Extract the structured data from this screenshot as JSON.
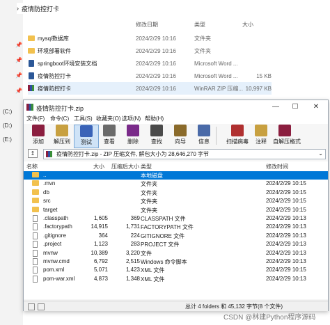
{
  "explorer": {
    "breadcrumb": "疫情防控打卡",
    "headers": {
      "date": "修改日期",
      "type": "类型",
      "size": "大小"
    },
    "rows": [
      {
        "name": "mysql数据库",
        "date": "2024/2/29 10:16",
        "type": "文件夹",
        "size": "",
        "icon": "folder"
      },
      {
        "name": "环境部署软件",
        "date": "2024/2/29 10:16",
        "type": "文件夹",
        "size": "",
        "icon": "folder"
      },
      {
        "name": "springboot环境安装文档",
        "date": "2024/2/29 10:16",
        "type": "Microsoft Word ...",
        "size": "",
        "icon": "word"
      },
      {
        "name": "疫情防控打卡",
        "date": "2024/2/29 10:16",
        "type": "Microsoft Word ...",
        "size": "15 KB",
        "icon": "word"
      },
      {
        "name": "疫情防控打卡",
        "date": "2024/2/29 10:16",
        "type": "WinRAR ZIP 压缩...",
        "size": "10,997 KB",
        "icon": "rar"
      }
    ],
    "drives": [
      "(C:)",
      "(D:)",
      "(E:)"
    ]
  },
  "winrar": {
    "title": "疫情防控打卡.zip",
    "window_buttons": {
      "min": "—",
      "max": "☐",
      "close": "✕"
    },
    "menu": [
      "文件(F)",
      "命令(C)",
      "工具(S)",
      "收藏夹(O)",
      "选项(N)",
      "帮助(H)"
    ],
    "toolbar": [
      {
        "label": "添加",
        "icon": "add-icon",
        "color": "#8b1e3f"
      },
      {
        "label": "解压到",
        "icon": "extract-to-icon",
        "color": "#c8a040"
      },
      {
        "label": "测试",
        "icon": "test-icon",
        "color": "#3a63b8"
      },
      {
        "label": "查看",
        "icon": "view-icon",
        "color": "#6a6a6a"
      },
      {
        "label": "删除",
        "icon": "delete-icon",
        "color": "#7a2a8a"
      },
      {
        "label": "查找",
        "icon": "find-icon",
        "color": "#4a4a4a"
      },
      {
        "label": "向导",
        "icon": "wizard-icon",
        "color": "#8a6a2a"
      },
      {
        "label": "信息",
        "icon": "info-icon",
        "color": "#4a6aa8"
      },
      {
        "label": "扫描病毒",
        "icon": "scan-virus-icon",
        "color": "#b03030"
      },
      {
        "label": "注释",
        "icon": "comment-icon",
        "color": "#c8a040"
      },
      {
        "label": "自解压格式",
        "icon": "sfx-icon",
        "color": "#8b1e3f"
      }
    ],
    "path": "疫情防控打卡.zip - ZIP 压缩文件, 解包大小为 28,646,270 字节",
    "columns": {
      "name": "名称",
      "size": "大小",
      "packed": "压缩后大小",
      "type": "类型",
      "modified": "修改时间"
    },
    "files": [
      {
        "name": "..",
        "size": "",
        "packed": "",
        "type": "本地磁盘",
        "modified": "",
        "kind": "folder",
        "selected": true
      },
      {
        "name": ".mvn",
        "size": "",
        "packed": "",
        "type": "文件夹",
        "modified": "2024/2/29 10:15",
        "kind": "folder"
      },
      {
        "name": "db",
        "size": "",
        "packed": "",
        "type": "文件夹",
        "modified": "2024/2/29 10:15",
        "kind": "folder"
      },
      {
        "name": "src",
        "size": "",
        "packed": "",
        "type": "文件夹",
        "modified": "2024/2/29 10:15",
        "kind": "folder"
      },
      {
        "name": "target",
        "size": "",
        "packed": "",
        "type": "文件夹",
        "modified": "2024/2/29 10:15",
        "kind": "folder"
      },
      {
        "name": ".classpath",
        "size": "1,605",
        "packed": "369",
        "type": "CLASSPATH 文件",
        "modified": "2024/2/29 10:13",
        "kind": "file"
      },
      {
        "name": ".factorypath",
        "size": "14,915",
        "packed": "1,731",
        "type": "FACTORYPATH 文件",
        "modified": "2024/2/29 10:13",
        "kind": "file"
      },
      {
        "name": ".gitignore",
        "size": "364",
        "packed": "224",
        "type": "GITIGNORE 文件",
        "modified": "2024/2/29 10:13",
        "kind": "file"
      },
      {
        "name": ".project",
        "size": "1,123",
        "packed": "283",
        "type": "PROJECT 文件",
        "modified": "2024/2/29 10:13",
        "kind": "file"
      },
      {
        "name": "mvnw",
        "size": "10,389",
        "packed": "3,220",
        "type": "文件",
        "modified": "2024/2/29 10:13",
        "kind": "file"
      },
      {
        "name": "mvnw.cmd",
        "size": "6,792",
        "packed": "2,515",
        "type": "Windows 命令脚本",
        "modified": "2024/2/29 10:13",
        "kind": "file"
      },
      {
        "name": "pom.xml",
        "size": "5,071",
        "packed": "1,423",
        "type": "XML 文件",
        "modified": "2024/2/29 10:15",
        "kind": "file"
      },
      {
        "name": "pom-war.xml",
        "size": "4,873",
        "packed": "1,348",
        "type": "XML 文件",
        "modified": "2024/2/29 10:13",
        "kind": "file"
      }
    ],
    "status": "总计 4 folders 和 45,132 字节(8 个文件)"
  },
  "watermark": "CSDN @林建Python程序源码"
}
